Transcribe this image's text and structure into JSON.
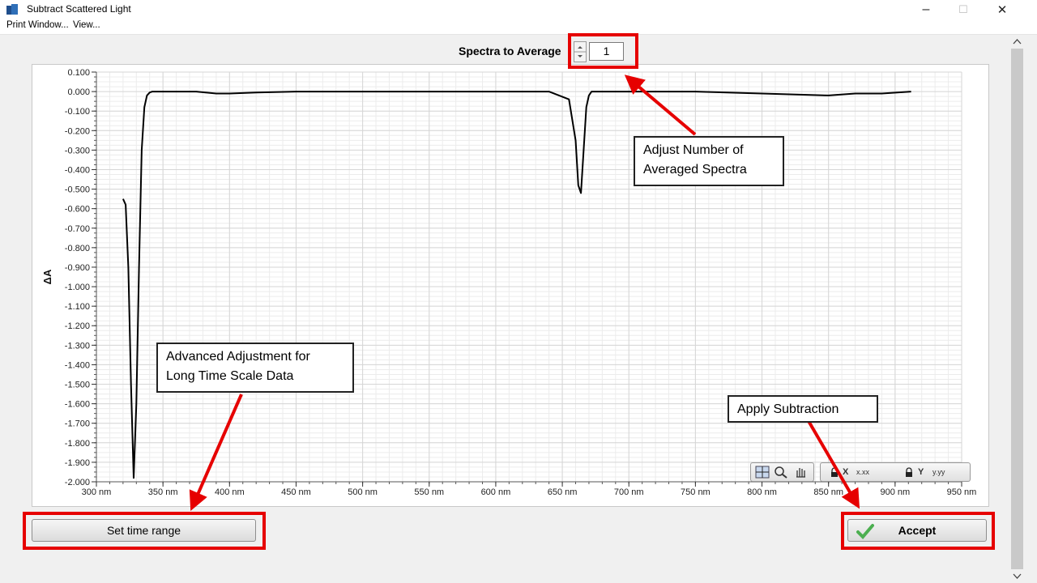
{
  "window": {
    "title": "Subtract Scattered Light",
    "icon": "app-icon",
    "controls": [
      "minimize",
      "maximize",
      "close"
    ],
    "control_glyphs": {
      "minimize": "–",
      "maximize": "☐",
      "close": "✕"
    }
  },
  "menu": [
    {
      "label": "Print Window..."
    },
    {
      "label": "View..."
    }
  ],
  "spectra": {
    "label": "Spectra to Average",
    "value": "1"
  },
  "buttons": {
    "set_time_range": "Set time range",
    "accept": "Accept"
  },
  "callouts": {
    "averaged": [
      "Adjust Number of",
      "Averaged Spectra"
    ],
    "advanced": [
      "Advanced Adjustment for",
      "Long Time Scale Data"
    ],
    "apply": "Apply Subtraction"
  },
  "toolbar": {
    "group1": [
      "crosshair-icon",
      "zoom-icon",
      "pan-hand-icon"
    ],
    "group2": [
      "lock-x-icon",
      "autoscale-x-icon",
      "x-format-icon",
      "lock-y-icon",
      "autoscale-y-icon",
      "y-format-icon"
    ],
    "x_format_label": "x.xx",
    "y_format_label": "y.yy",
    "x_lock_label": "X",
    "y_lock_label": "Y"
  },
  "colors": {
    "annotation": "#e60000",
    "trace": "#000000"
  },
  "chart_data": {
    "type": "line",
    "xlabel": "",
    "ylabel": "ΔA",
    "xlim": [
      300,
      950
    ],
    "ylim": [
      -2.0,
      0.1
    ],
    "x_ticks": [
      "300 nm",
      "350 nm",
      "400 nm",
      "450 nm",
      "500 nm",
      "550 nm",
      "600 nm",
      "650 nm",
      "700 nm",
      "750 nm",
      "800 nm",
      "850 nm",
      "900 nm",
      "950 nm"
    ],
    "y_ticks": [
      "0.100",
      "0.000",
      "-0.100",
      "-0.200",
      "-0.300",
      "-0.400",
      "-0.500",
      "-0.600",
      "-0.700",
      "-0.800",
      "-0.900",
      "-1.000",
      "-1.100",
      "-1.200",
      "-1.300",
      "-1.400",
      "-1.500",
      "-1.600",
      "-1.700",
      "-1.800",
      "-1.900",
      "-2.000"
    ],
    "grid": true,
    "series": [
      {
        "x": [
          320,
          322,
          324,
          326,
          328,
          330,
          332,
          334,
          336,
          338,
          340,
          342,
          345,
          350,
          360,
          375,
          390,
          400,
          420,
          450,
          500,
          550,
          600,
          640,
          655,
          660,
          662,
          664,
          666,
          668,
          670,
          672,
          675,
          680,
          700,
          750,
          800,
          850,
          870,
          890,
          912
        ],
        "y": [
          -0.55,
          -0.58,
          -0.9,
          -1.5,
          -1.98,
          -1.6,
          -0.9,
          -0.3,
          -0.08,
          -0.02,
          -0.005,
          0.0,
          0.0,
          0.0,
          0.0,
          0.0,
          -0.01,
          -0.01,
          -0.005,
          0.0,
          0.0,
          0.0,
          0.0,
          0.0,
          -0.04,
          -0.25,
          -0.48,
          -0.52,
          -0.3,
          -0.08,
          -0.02,
          0.0,
          0.0,
          0.0,
          0.0,
          0.0,
          -0.01,
          -0.02,
          -0.01,
          -0.01,
          0.0
        ]
      }
    ]
  }
}
